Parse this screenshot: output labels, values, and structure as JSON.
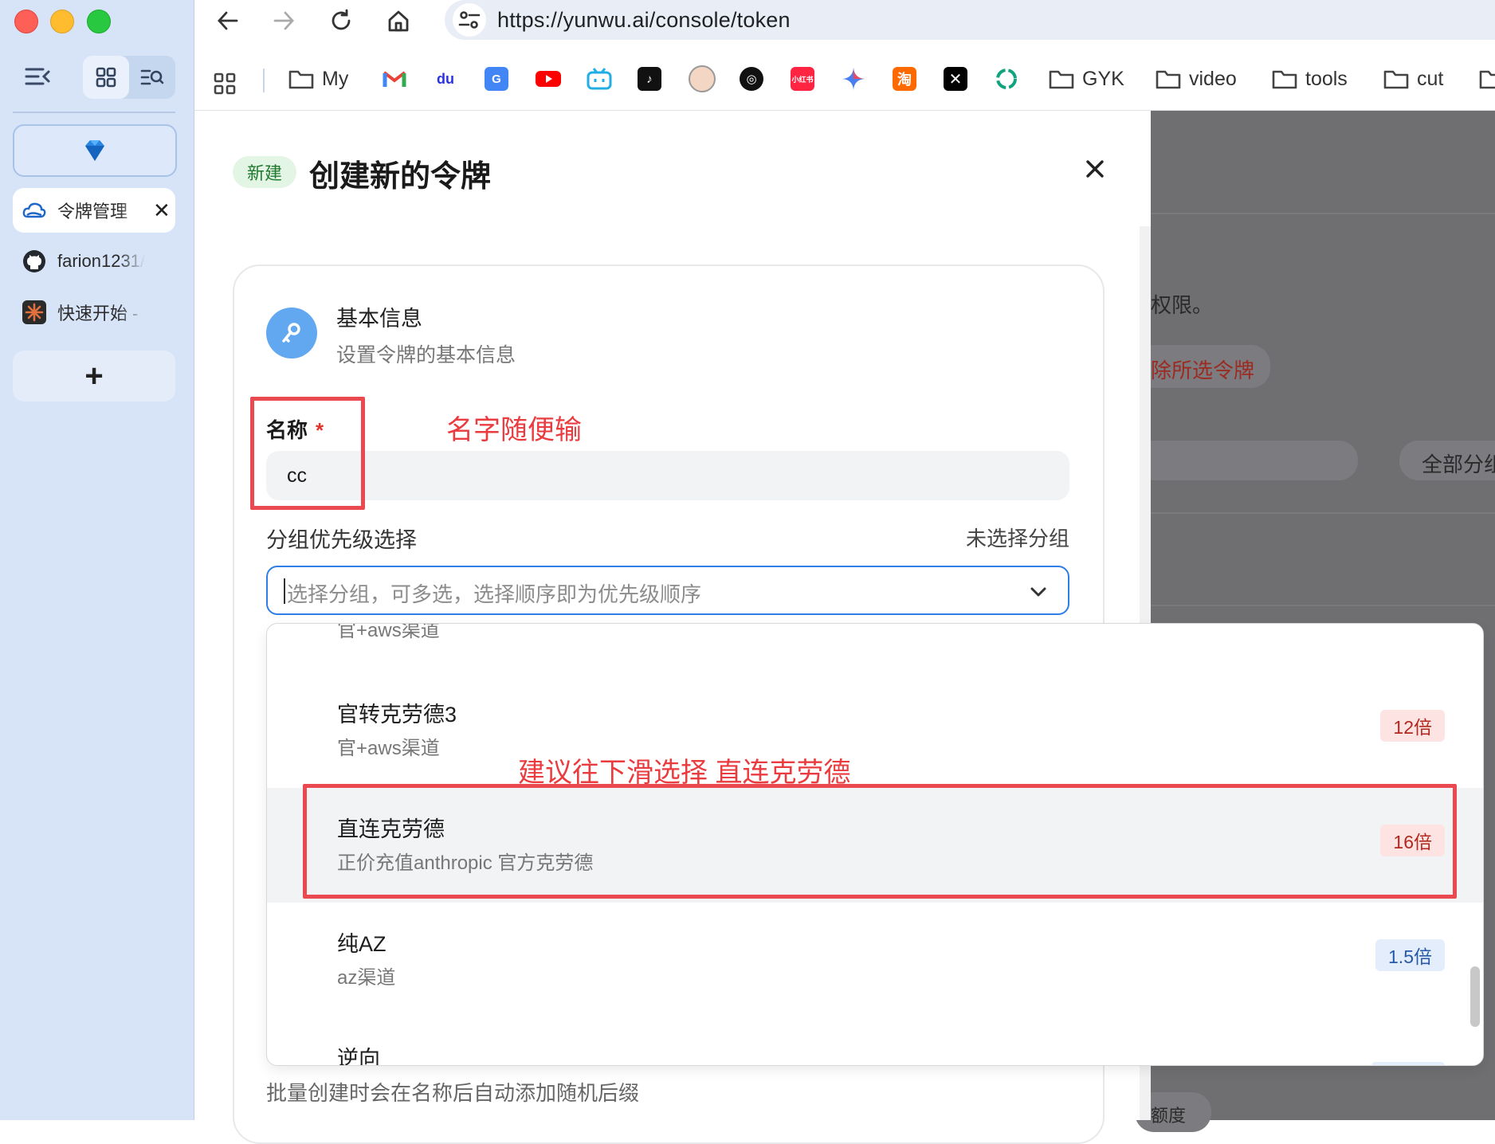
{
  "browser": {
    "url": "https://yunwu.ai/console/token",
    "bookmarks": [
      {
        "icon": "folder-icon",
        "label": "My"
      },
      {
        "icon": "gmail-icon",
        "label": ""
      },
      {
        "icon": "baidu-icon",
        "label": ""
      },
      {
        "icon": "google-translate-icon",
        "label": ""
      },
      {
        "icon": "youtube-icon",
        "label": ""
      },
      {
        "icon": "bilibili-icon",
        "label": ""
      },
      {
        "icon": "tiktok-icon",
        "label": ""
      },
      {
        "icon": "avatar-icon",
        "label": ""
      },
      {
        "icon": "openai-icon",
        "label": ""
      },
      {
        "icon": "xiaohongshu-icon",
        "label": "小红书"
      },
      {
        "icon": "gemini-icon",
        "label": ""
      },
      {
        "icon": "taobao-icon",
        "label": "淘"
      },
      {
        "icon": "x-icon",
        "label": ""
      },
      {
        "icon": "chatgpt-icon",
        "label": ""
      },
      {
        "icon": "folder-icon",
        "label": "GYK"
      },
      {
        "icon": "folder-icon",
        "label": "video"
      },
      {
        "icon": "folder-icon",
        "label": "tools"
      },
      {
        "icon": "folder-icon",
        "label": "cut"
      }
    ]
  },
  "sidebar": {
    "tabs": [
      {
        "label": "令牌管理",
        "icon": "cloud-icon",
        "active": true
      },
      {
        "label": "farion1231/",
        "icon": "github-icon",
        "active": false
      },
      {
        "label": "快速开始 - ",
        "icon": "claude-icon",
        "active": false
      }
    ],
    "new_tab": "+"
  },
  "modal": {
    "badge": "新建",
    "title": "创建新的令牌",
    "section_title": "基本信息",
    "section_subtitle": "设置令牌的基本信息",
    "name_label": "名称",
    "required_mark": "*",
    "name_value": "cc",
    "group_label": "分组优先级选择",
    "group_status": "未选择分组",
    "group_placeholder": "选择分组，可多选，选择顺序即为优先级顺序",
    "helper_text": "批量创建时会在名称后自动添加随机后缀"
  },
  "dropdown": {
    "partial_top": "官+aws渠道",
    "options": [
      {
        "name": "官转克劳德3",
        "desc": "官+aws渠道",
        "tag": "12倍",
        "tag_color": "red"
      },
      {
        "name": "直连克劳德",
        "desc": "正价充值anthropic 官方克劳德",
        "tag": "16倍",
        "tag_color": "red",
        "highlighted": true
      },
      {
        "name": "纯AZ",
        "desc": "az渠道",
        "tag": "1.5倍",
        "tag_color": "blue"
      },
      {
        "name": "逆向",
        "desc": "",
        "tag": "",
        "tag_color": "blue"
      }
    ]
  },
  "annotations": {
    "name_hint": "名字随便输",
    "scroll_hint": "建议往下滑选择 直连克劳德"
  },
  "background_page": {
    "text1": "权限。",
    "text2": "除所选令牌",
    "text3": "全部分组",
    "text4": "额度"
  },
  "colors": {
    "accent_blue": "#2f7ee8",
    "annotation_red": "#ea4a4f",
    "sidebar_bg": "#d7e4f8"
  }
}
